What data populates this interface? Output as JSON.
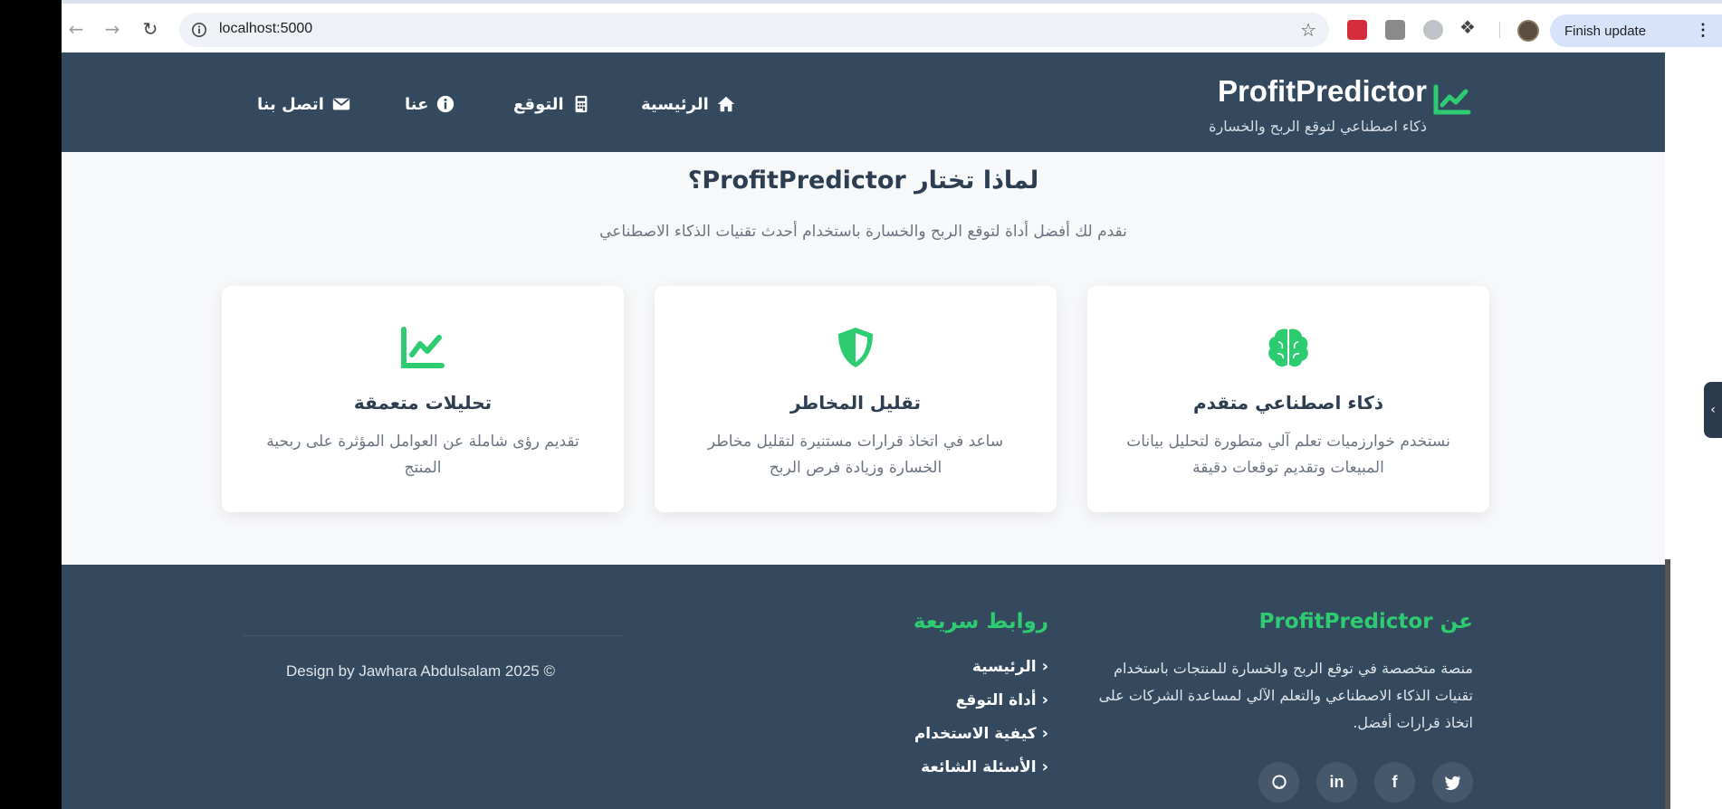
{
  "browser": {
    "url": "localhost:5000",
    "update_label": "Finish update"
  },
  "header": {
    "brand_name": "ProfitPredictor",
    "brand_tagline": "ذكاء اصطناعي لتوقع الربح والخسارة",
    "nav": {
      "home": "الرئيسية",
      "predict": "التوقع",
      "about": "عنا",
      "contact": "اتصل بنا"
    }
  },
  "why": {
    "title": "لماذا تختار ProfitPredictor؟",
    "subtitle": "نقدم لك أفضل أداة لتوقع الربح والخسارة باستخدام أحدث تقنيات الذكاء الاصطناعي",
    "cards": [
      {
        "icon": "brain-icon",
        "title": "ذكاء اصطناعي متقدم",
        "desc": "نستخدم خوارزميات تعلم آلي متطورة لتحليل بيانات المبيعات وتقديم توقعات دقيقة"
      },
      {
        "icon": "shield-icon",
        "title": "تقليل المخاطر",
        "desc": "ساعد في اتخاذ قرارات مستنيرة لتقليل مخاطر الخسارة وزيادة فرص الربح"
      },
      {
        "icon": "chart-line-icon",
        "title": "تحليلات متعمقة",
        "desc": "تقديم رؤى شاملة عن العوامل المؤثرة على ربحية المنتج"
      }
    ]
  },
  "footer": {
    "about_title": "عن ProfitPredictor",
    "about_text": "منصة متخصصة في توقع الربح والخسارة للمنتجات باستخدام تقنيات الذكاء الاصطناعي والتعلم الآلي لمساعدة الشركات على اتخاذ قرارات أفضل.",
    "links_title": "روابط سريعة",
    "links": [
      "الرئيسية",
      "أداة التوقع",
      "كيفية الاستخدام",
      "الأسئلة الشائعة"
    ],
    "copyright": "Design by Jawhara Abdulsalam 2025 ©"
  },
  "colors": {
    "header_bg": "#34495e",
    "accent_green": "#2ecc71",
    "page_bg": "#f7f8fa"
  }
}
